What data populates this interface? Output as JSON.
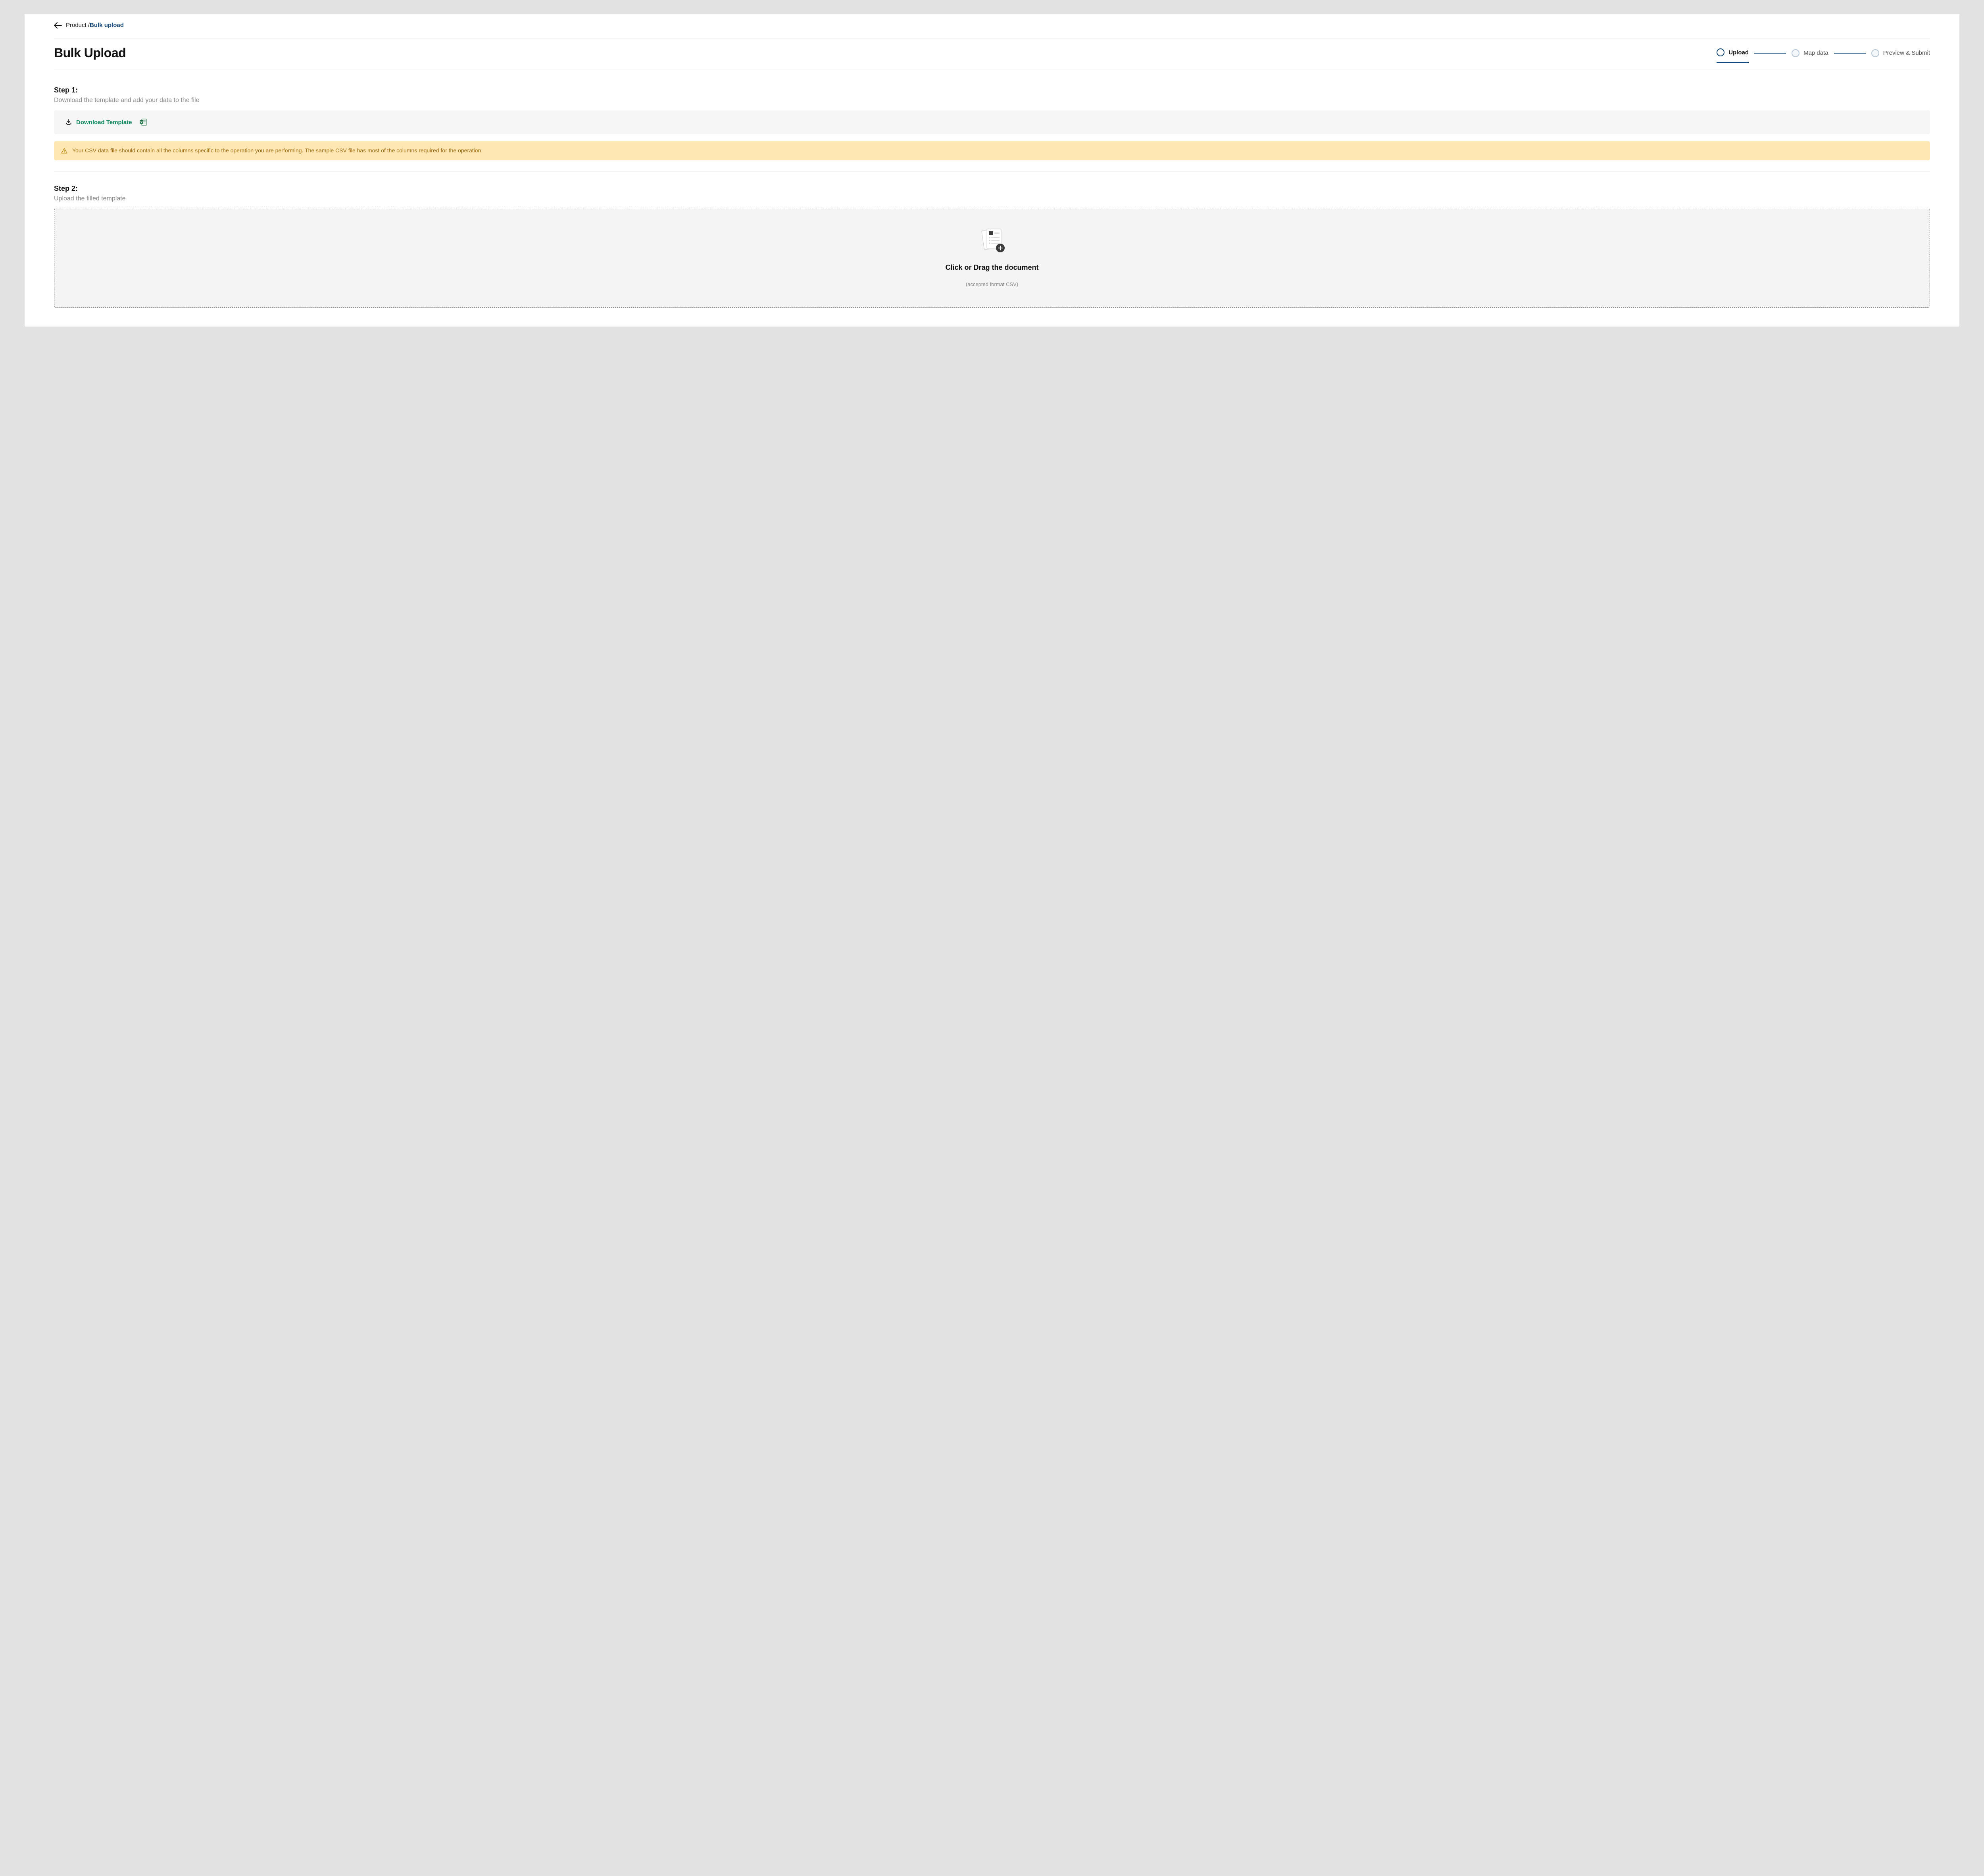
{
  "breadcrumb": {
    "parent": "Product /",
    "current": "Bulk upload"
  },
  "page_title": "Bulk Upload",
  "stepper": {
    "steps": [
      {
        "label": "Upload",
        "active": true
      },
      {
        "label": "Map data",
        "active": false
      },
      {
        "label": "Preview & Submit",
        "active": false
      }
    ]
  },
  "step1": {
    "heading": "Step 1:",
    "sub": "Download the template and add your data to the file",
    "download_label": "Download Template"
  },
  "warning": {
    "text": "Your CSV data file should contain all the columns specific to the operation you are performing. The sample CSV file has most of the columns required for the operation."
  },
  "step2": {
    "heading": "Step 2:",
    "sub": "Upload the filled template",
    "dropzone_title": "Click or Drag the document",
    "dropzone_sub": "(accepted format CSV)"
  },
  "colors": {
    "accent": "#174a7c",
    "green": "#0f8a5f",
    "warning_bg": "#ffe7b3",
    "warning_text": "#9a6a12"
  }
}
